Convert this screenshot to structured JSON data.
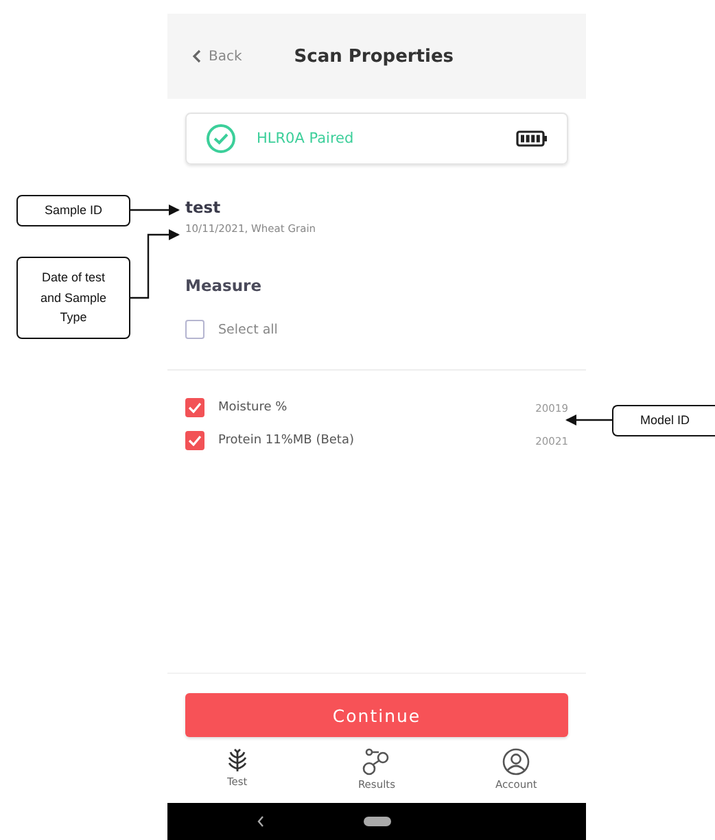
{
  "header": {
    "back": "Back",
    "title": "Scan Properties"
  },
  "device": {
    "name": "HLR0A Paired",
    "paired": true
  },
  "sample": {
    "name": "test",
    "details": "10/11/2021, Wheat Grain"
  },
  "measure": {
    "title": "Measure",
    "select_all": {
      "label": "Select all",
      "checked": false
    },
    "items": [
      {
        "name": "Moisture %",
        "model_id": "20019",
        "checked": true
      },
      {
        "name": "Protein 11%MB (Beta)",
        "model_id": "20021",
        "checked": true
      }
    ]
  },
  "continue_button": "Continue",
  "nav": [
    {
      "label": "Test"
    },
    {
      "label": "Results"
    },
    {
      "label": "Account"
    }
  ],
  "annotations": [
    {
      "label": "Sample ID"
    },
    {
      "label": "Date of test and Sample Type"
    },
    {
      "label": "Model ID"
    }
  ]
}
